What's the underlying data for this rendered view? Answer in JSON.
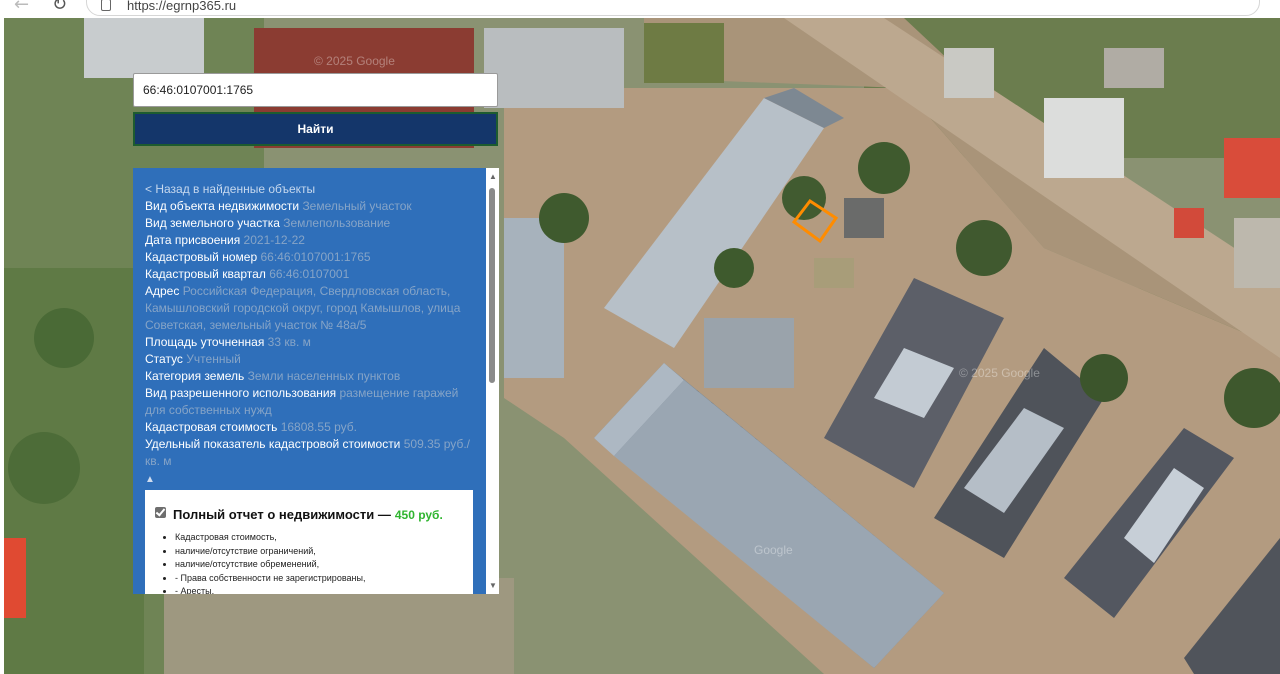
{
  "browser": {
    "url": "https://egrnp365.ru",
    "back_icon": "arrow-left",
    "reload_icon": "reload"
  },
  "map": {
    "watermarks": [
      "© 2025 Google",
      "© 2025 Google",
      "Google"
    ]
  },
  "search": {
    "value": "66:46:0107001:1765",
    "button_label": "Найти"
  },
  "panel": {
    "back_link": "< Назад в найденные объекты",
    "fields": [
      {
        "label": "Вид объекта недвижимости",
        "value": "Земельный участок"
      },
      {
        "label": "Вид земельного участка",
        "value": "Землепользование"
      },
      {
        "label": "Дата присвоения",
        "value": "2021-12-22"
      },
      {
        "label": "Кадастровый номер",
        "value": "66:46:0107001:1765"
      },
      {
        "label": "Кадастровый квартал",
        "value": "66:46:0107001"
      },
      {
        "label": "Адрес",
        "value": "Российская Федерация, Свердловская область, Камышловский городской округ, город Камышлов, улица Советская, земельный участок № 48а/5"
      },
      {
        "label": "Площадь уточненная",
        "value": "33 кв. м"
      },
      {
        "label": "Статус",
        "value": "Учтенный"
      },
      {
        "label": "Категория земель",
        "value": "Земли населенных пунктов"
      },
      {
        "label": "Вид разрешенного использования",
        "value": "размещение гаражей для собственных нужд"
      },
      {
        "label": "Кадастровая стоимость",
        "value": "16808.55 руб."
      },
      {
        "label": "Удельный показатель кадастровой стоимости",
        "value": "509.35 руб./кв. м"
      }
    ],
    "collapse_symbol": "▲",
    "report": {
      "title": "Полный отчет о недвижимости —",
      "price": "450 руб.",
      "items": [
        "Кадастровая стоимость,",
        "наличие/отсутствие ограничений,",
        "наличие/отсутствие обременений,",
        "- Права собственности не зарегистрированы,",
        "- Аресты,"
      ]
    }
  },
  "colors": {
    "button_bg": "#14366a",
    "panel_bg": "#2f6fba",
    "price": "#2fb52f",
    "parcel_outline": "#ff8c00"
  }
}
